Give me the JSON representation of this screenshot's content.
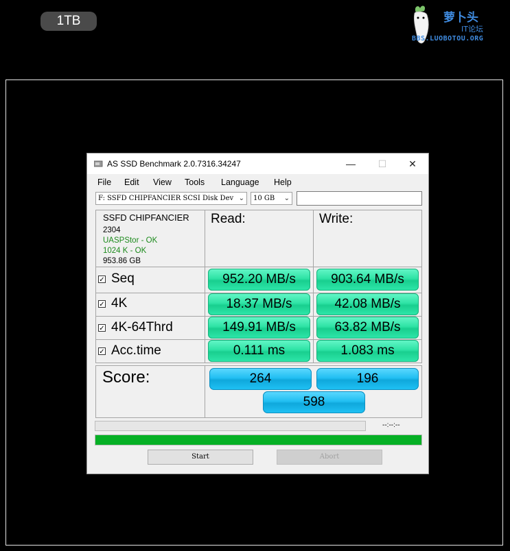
{
  "capacity_label": "1TB",
  "watermark": {
    "name": "萝卜头",
    "sub": "IT论坛",
    "url": "BBS.LUOBOTOU.ORG"
  },
  "window": {
    "title": "AS SSD Benchmark 2.0.7316.34247",
    "controls": {
      "minimize": "—",
      "maximize": "☐",
      "close": "✕"
    }
  },
  "menu": [
    "File",
    "Edit",
    "View",
    "Tools",
    "Language",
    "Help"
  ],
  "drive_select": {
    "value": "F: SSFD CHIPFANCIER SCSI Disk Dev"
  },
  "size_select": {
    "value": "10 GB"
  },
  "drive_info": {
    "model": "SSFD CHIPFANCIER",
    "firmware": "2304",
    "driver_status": "UASPStor - OK",
    "alignment_status": "1024 K - OK",
    "capacity": "953.86 GB"
  },
  "headers": {
    "read": "Read:",
    "write": "Write:"
  },
  "tests": [
    {
      "label": "Seq",
      "checked": true,
      "read": "952.20 MB/s",
      "write": "903.64 MB/s"
    },
    {
      "label": "4K",
      "checked": true,
      "read": "18.37 MB/s",
      "write": "42.08 MB/s"
    },
    {
      "label": "4K-64Thrd",
      "checked": true,
      "read": "149.91 MB/s",
      "write": "63.82 MB/s"
    },
    {
      "label": "Acc.time",
      "checked": true,
      "read": "0.111 ms",
      "write": "1.083 ms"
    }
  ],
  "score": {
    "label": "Score:",
    "read": "264",
    "write": "196",
    "total": "598"
  },
  "progress": {
    "test_fraction": 0,
    "overall_fraction": 1.0,
    "timer": "--:--:--"
  },
  "buttons": {
    "start": "Start",
    "abort": "Abort"
  },
  "colors": {
    "result_green": "#2ee3a5",
    "score_blue": "#22bff2",
    "progress_green": "#06b025"
  }
}
